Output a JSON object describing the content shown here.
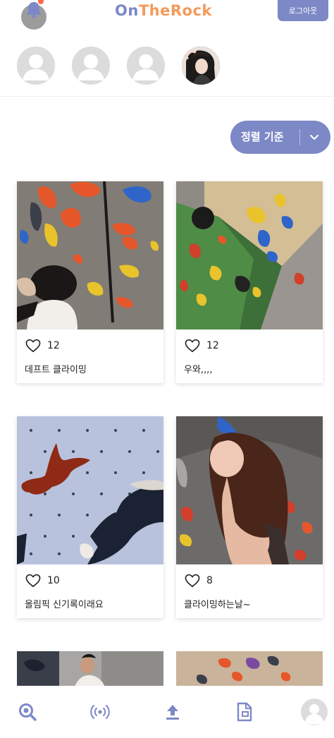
{
  "header": {
    "logo_part1": "On",
    "logo_part2": "The",
    "logo_part3": "Rock",
    "logout_label": "로그아웃",
    "notification_icon": "bell-icon"
  },
  "stories": [
    {
      "type": "default-avatar"
    },
    {
      "type": "default-avatar"
    },
    {
      "type": "default-avatar"
    },
    {
      "type": "photo-avatar"
    }
  ],
  "sort": {
    "label": "정렬 기준",
    "icon": "chevron-down-icon"
  },
  "posts": [
    {
      "likes": "12",
      "caption": "데프트 클라이밍"
    },
    {
      "likes": "12",
      "caption": "우와,,,,"
    },
    {
      "likes": "10",
      "caption": "올림픽 신기록이래요"
    },
    {
      "likes": "8",
      "caption": "클라이밍하는날~"
    }
  ],
  "bottom_nav": [
    {
      "icon": "search-icon"
    },
    {
      "icon": "live-broadcast-icon"
    },
    {
      "icon": "upload-icon"
    },
    {
      "icon": "document-icon"
    },
    {
      "icon": "profile-avatar-icon"
    }
  ],
  "colors": {
    "accent": "#7d88c7",
    "logo_orange": "#f39a5c"
  }
}
